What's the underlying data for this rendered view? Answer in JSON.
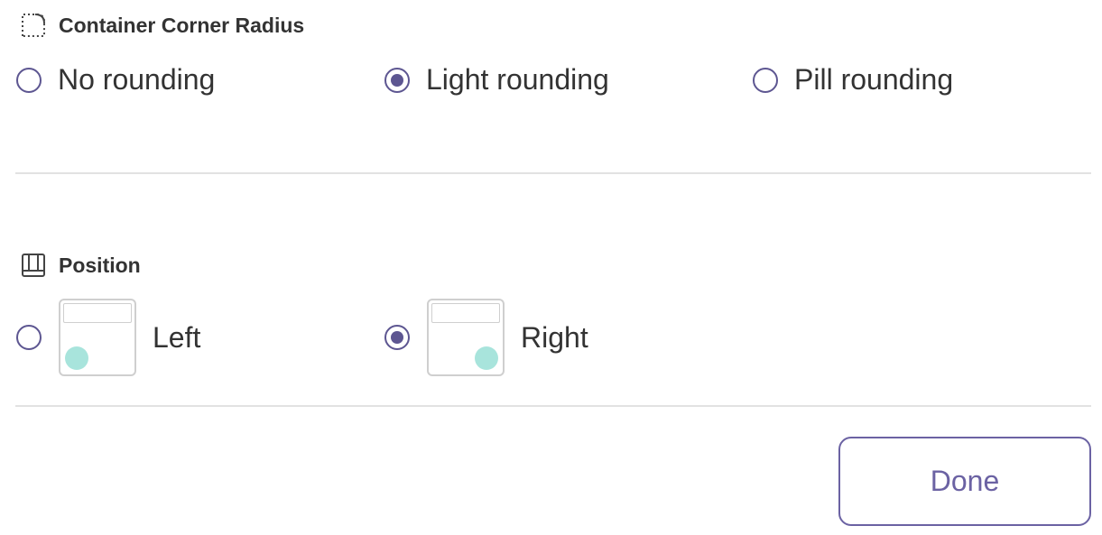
{
  "corner_radius": {
    "title": "Container Corner Radius",
    "icon": "dotted-corner-icon",
    "options": [
      {
        "label": "No rounding",
        "checked": false
      },
      {
        "label": "Light rounding",
        "checked": true
      },
      {
        "label": "Pill rounding",
        "checked": false
      }
    ]
  },
  "position": {
    "title": "Position",
    "icon": "layout-panel-icon",
    "options": [
      {
        "label": "Left",
        "checked": false,
        "preview": "bottom-left"
      },
      {
        "label": "Right",
        "checked": true,
        "preview": "bottom-right"
      }
    ]
  },
  "done_label": "Done",
  "colors": {
    "radio_accent": "#5d5691",
    "button_accent": "#6b62a3",
    "bubble": "#a8e4dc",
    "divider": "#e2e2e2"
  }
}
